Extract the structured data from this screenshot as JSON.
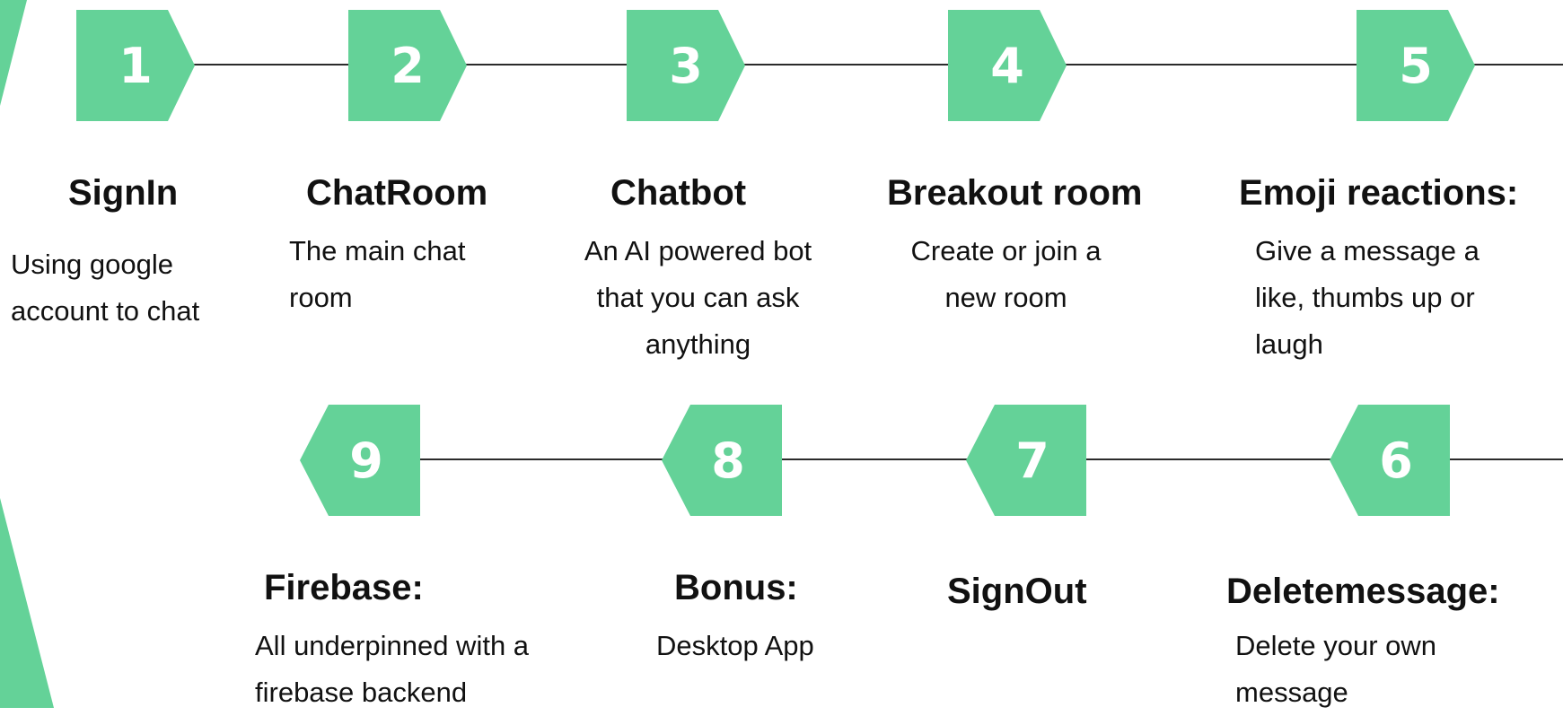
{
  "colors": {
    "accent": "#64d298",
    "line": "#2b2b2b",
    "text": "#111111"
  },
  "steps": [
    {
      "number": "1",
      "title": "SignIn",
      "description": "Using google account to chat"
    },
    {
      "number": "2",
      "title": "ChatRoom",
      "description": "The main chat room"
    },
    {
      "number": "3",
      "title": "Chatbot",
      "description": "An AI powered bot that you can ask anything"
    },
    {
      "number": "4",
      "title": "Breakout room",
      "description": "Create or join a new room"
    },
    {
      "number": "5",
      "title": "Emoji reactions:",
      "description": "Give a message a like, thumbs up or laugh"
    },
    {
      "number": "6",
      "title": "Deletemessage:",
      "description": "Delete your own message"
    },
    {
      "number": "7",
      "title": "SignOut",
      "description": ""
    },
    {
      "number": "8",
      "title": "Bonus:",
      "description": "Desktop App"
    },
    {
      "number": "9",
      "title": "Firebase:",
      "description": "All underpinned with a firebase backend"
    }
  ]
}
